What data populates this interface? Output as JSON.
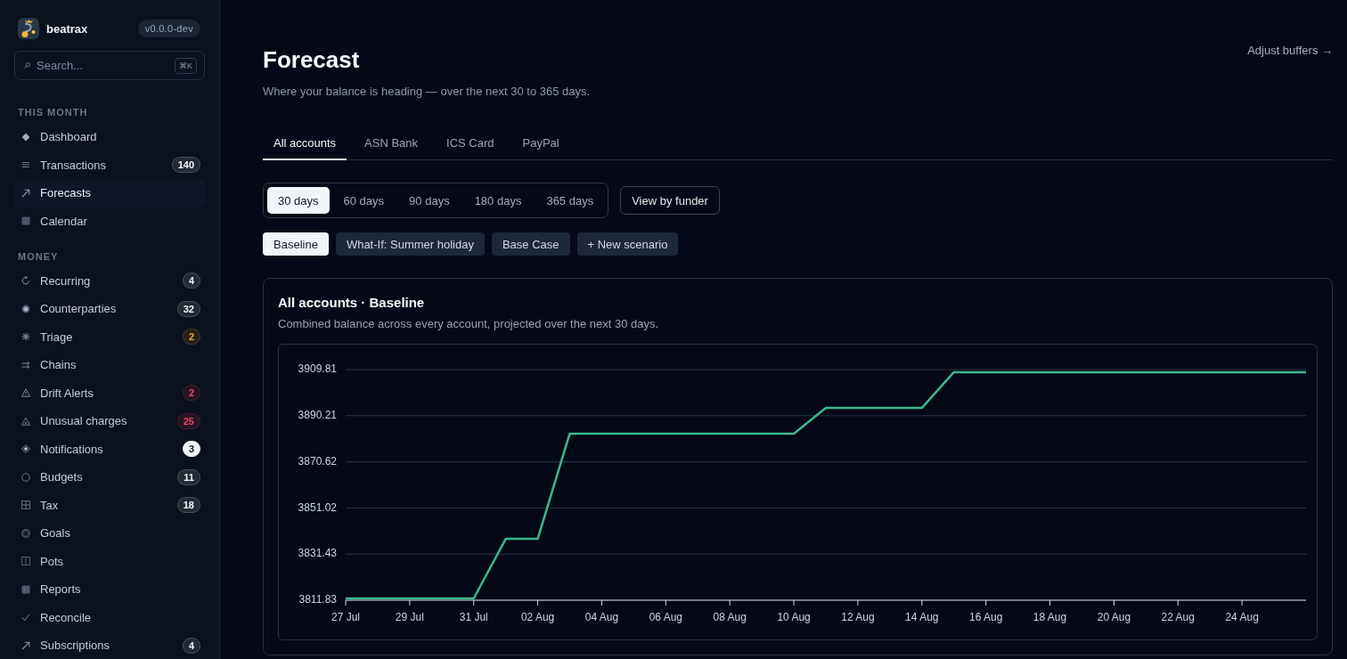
{
  "sidebar": {
    "brand": "beatrax",
    "version": "v0.0.0-dev",
    "search": {
      "placeholder": "Search...",
      "shortcut": "⌘K"
    },
    "sections": [
      {
        "heading": "THIS MONTH",
        "items": [
          {
            "label": "Dashboard",
            "selected": false
          },
          {
            "label": "Transactions",
            "selected": false,
            "badge": {
              "text": "140",
              "color": "#f1f5f9",
              "filled": false
            }
          },
          {
            "label": "Forecasts",
            "selected": true
          },
          {
            "label": "Calendar",
            "selected": false
          }
        ]
      },
      {
        "heading": "MONEY",
        "items": [
          {
            "label": "Recurring",
            "selected": false,
            "badge": {
              "text": "4",
              "color": "#f1f5f9",
              "filled": false
            }
          },
          {
            "label": "Counterparties",
            "selected": false,
            "badge": {
              "text": "32",
              "color": "#f1f5f9",
              "filled": false
            }
          },
          {
            "label": "Triage",
            "selected": false,
            "badge": {
              "text": "2",
              "color": "#f0a832",
              "filled": false
            }
          },
          {
            "label": "Chains",
            "selected": false
          },
          {
            "label": "Drift Alerts",
            "selected": false,
            "badge": {
              "text": "2",
              "color": "#f0435f",
              "filled": false
            }
          },
          {
            "label": "Unusual charges",
            "selected": false,
            "badge": {
              "text": "25",
              "color": "#f0435f",
              "filled": false
            }
          },
          {
            "label": "Notifications",
            "selected": false,
            "badge": {
              "text": "3",
              "color": "#f1f5f9",
              "filled": true
            }
          },
          {
            "label": "Budgets",
            "selected": false,
            "badge": {
              "text": "11",
              "color": "#f1f5f9",
              "filled": false
            }
          },
          {
            "label": "Tax",
            "selected": false,
            "badge": {
              "text": "18",
              "color": "#f1f5f9",
              "filled": false
            }
          },
          {
            "label": "Goals",
            "selected": false
          },
          {
            "label": "Pots",
            "selected": false
          },
          {
            "label": "Reports",
            "selected": false
          },
          {
            "label": "Reconcile",
            "selected": false
          },
          {
            "label": "Subscriptions",
            "selected": false,
            "badge": {
              "text": "4",
              "color": "#f1f5f9",
              "filled": false
            }
          }
        ]
      }
    ]
  },
  "header": {
    "title": "Forecast",
    "subtitle": "Where your balance is heading — over the next 30 to 365 days.",
    "link": "Adjust buffers →"
  },
  "account_tabs": [
    {
      "label": "All accounts",
      "selected": true
    },
    {
      "label": "ASN Bank",
      "selected": false
    },
    {
      "label": "ICS Card",
      "selected": false
    },
    {
      "label": "PayPal",
      "selected": false
    }
  ],
  "ranges": [
    {
      "label": "30 days",
      "selected": true
    },
    {
      "label": "60 days",
      "selected": false
    },
    {
      "label": "90 days",
      "selected": false
    },
    {
      "label": "180 days",
      "selected": false
    },
    {
      "label": "365 days",
      "selected": false
    }
  ],
  "view_button": "View by funder",
  "scenarios": [
    {
      "label": "Baseline",
      "selected": true
    },
    {
      "label": "What-If: Summer holiday",
      "selected": false
    },
    {
      "label": "Base Case",
      "selected": false
    }
  ],
  "new_scenario_button": "+ New scenario",
  "card": {
    "title": "All accounts · Baseline",
    "subtitle": "Combined balance across every account, projected over the next 30 days.",
    "chart_data": {
      "type": "line",
      "categories": [
        "27 Jul",
        null,
        "29 Jul",
        null,
        "31 Jul",
        null,
        "02 Aug",
        null,
        "04 Aug",
        null,
        "06 Aug",
        null,
        "08 Aug",
        null,
        "10 Aug",
        null,
        "12 Aug",
        null,
        "14 Aug",
        null,
        "16 Aug",
        null,
        "18 Aug",
        null,
        "20 Aug",
        null,
        "22 Aug",
        null,
        "24 Aug",
        null,
        null
      ],
      "values": [
        3812.6,
        3812.6,
        3812.6,
        3812.6,
        3812.6,
        3837.9,
        3837.9,
        3882.6,
        3882.6,
        3882.6,
        3882.6,
        3882.6,
        3882.6,
        3882.6,
        3882.6,
        3893.5,
        3893.5,
        3893.5,
        3893.5,
        3908.7,
        3908.7,
        3908.7,
        3908.7,
        3908.7,
        3908.7,
        3908.7,
        3908.7,
        3908.7,
        3908.7,
        3908.7,
        3908.7
      ],
      "ylim": [
        3811.83,
        3909.81
      ],
      "yticks": [
        3811.83,
        3831.43,
        3851.02,
        3870.62,
        3890.21,
        3909.81
      ],
      "grid": true
    }
  }
}
